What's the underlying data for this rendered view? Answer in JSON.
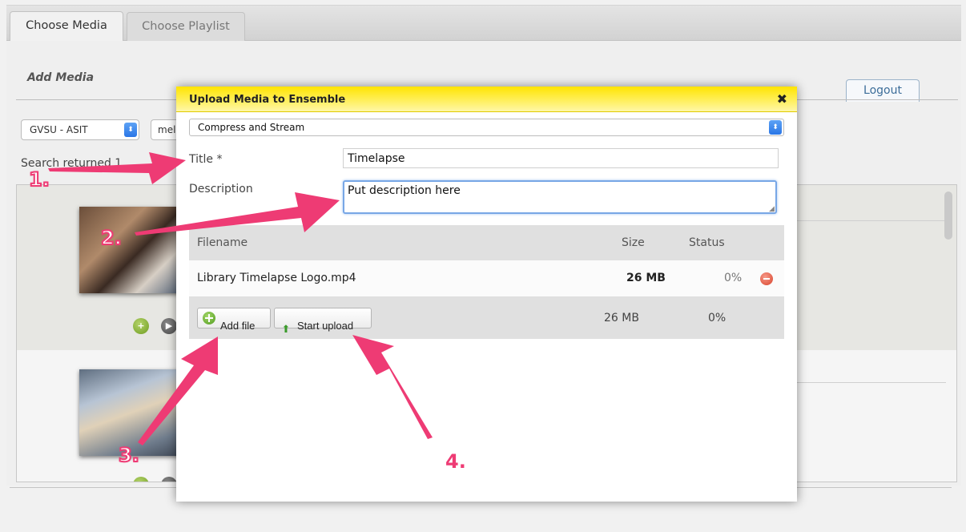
{
  "tabs": {
    "media": "Choose Media",
    "playlist": "Choose Playlist"
  },
  "section": {
    "title": "Add Media",
    "logout": "Logout"
  },
  "filters": {
    "org_select": "GVSU - ASIT",
    "second_select": "mel"
  },
  "search": {
    "text": "Search returned 1"
  },
  "modal": {
    "title": "Upload Media to Ensemble",
    "close": "✖",
    "mode": "Compress and Stream",
    "title_label": "Title *",
    "title_value": "Timelapse",
    "description_label": "Description",
    "description_value": "Put description here",
    "table": {
      "headers": {
        "filename": "Filename",
        "size": "Size",
        "status": "Status"
      },
      "rows": [
        {
          "filename": "Library Timelapse Logo.mp4",
          "size": "26 MB",
          "status": "0%"
        }
      ],
      "footer": {
        "size": "26 MB",
        "status": "0%"
      }
    },
    "buttons": {
      "add_file": "Add file",
      "start_upload": "Start upload"
    }
  },
  "annotations": {
    "step1": "1.",
    "step2": "2.",
    "step3": "3.",
    "step4": "4."
  },
  "icons": {
    "add": "plus-circle-icon",
    "upload": "up-arrow-icon",
    "remove": "minus-circle-icon",
    "select": "select-arrows-icon"
  },
  "colors": {
    "modal_header": "#ffe400",
    "annotation": "#ee3b74",
    "focus_border": "#78a7e6"
  }
}
